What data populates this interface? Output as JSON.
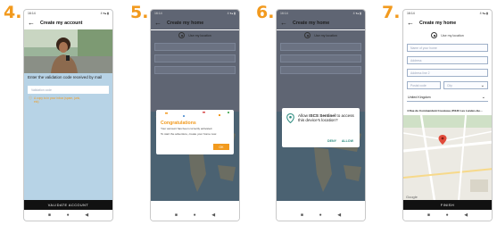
{
  "steps": [
    "4.",
    "5.",
    "6.",
    "7."
  ],
  "status_bar": {
    "time": "16:14",
    "icons": "4 ▾▴ ▮"
  },
  "nav_icons": [
    "■",
    "●",
    "◀"
  ],
  "back_glyph": "←",
  "screen4": {
    "title": "Create my account",
    "prompt": "Enter the validation code received by mail",
    "input_placeholder": "Validation code",
    "hint": "A copy to in your inbox (spam, junk, etc)",
    "button": "VALIDATE ACCOUNT"
  },
  "screen5": {
    "title": "Create my home",
    "use_location": "Use my location",
    "dialog_title": "Congratulations",
    "dialog_body1": "Your account has been correctly activated.",
    "dialog_body2": "To start the adventure, create your home now.",
    "dialog_button": "OK"
  },
  "screen6": {
    "title": "Create my home",
    "use_location": "Use my location",
    "perm_pre": "Allow ",
    "perm_app": "ISCS Sentinel",
    "perm_post": " to access this device's location?",
    "deny": "DENY",
    "allow": "ALLOW"
  },
  "screen7": {
    "title": "Create my home",
    "use_location": "Use my location",
    "fields": [
      "Name of your home",
      "Address",
      "Address line 2"
    ],
    "postal_code": "Postal code",
    "city": "City",
    "country": "United Kingdom",
    "address_line": "4 Rue du Commandant Cousteau, 85130 Les Landes-Ge...",
    "map_logo": "Google",
    "button": "FINISH"
  },
  "colors": {
    "accent": "#f29a1e",
    "map_water": "#a9c8dc",
    "map_land": "#e3dfcf"
  }
}
